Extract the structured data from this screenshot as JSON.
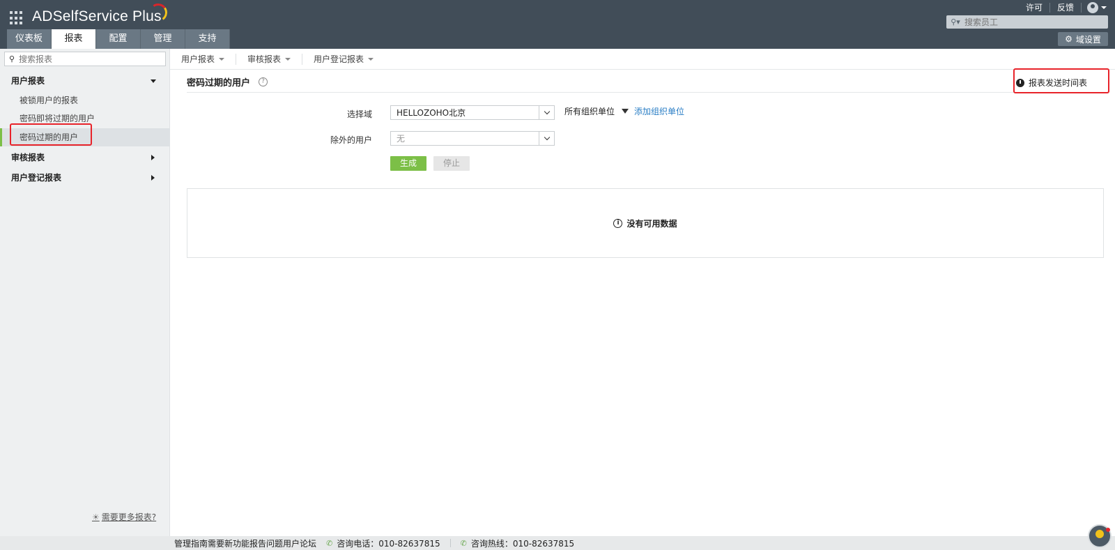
{
  "app": {
    "logo_main": "ADSelfService",
    "logo_plus": " Plus"
  },
  "top_links": [
    "许可",
    "反馈"
  ],
  "employee_search": {
    "placeholder": "搜索员工"
  },
  "nav_tabs": [
    "仪表板",
    "报表",
    "配置",
    "管理",
    "支持"
  ],
  "active_tab": "报表",
  "domain_settings_label": "域设置",
  "sidebar": {
    "search_placeholder": "搜索报表",
    "groups": [
      {
        "label": "用户报表",
        "expanded": true,
        "items": [
          "被锁用户的报表",
          "密码即将过期的用户",
          "密码过期的用户"
        ]
      },
      {
        "label": "审核报表",
        "expanded": false
      },
      {
        "label": "用户登记报表",
        "expanded": false
      }
    ],
    "active_item": "密码过期的用户",
    "more_reports": "需要更多报表?"
  },
  "subnav": [
    "用户报表",
    "审核报表",
    "用户登记报表"
  ],
  "page": {
    "title": "密码过期的用户",
    "help_symbol": "?",
    "schedule_label": "报表发送时间表",
    "form": {
      "domain_label": "选择域",
      "domain_value": "HELLOZOHO北京",
      "ou_text": "所有组织单位",
      "add_ou_link": "添加组织单位",
      "exclude_label": "除外的用户",
      "exclude_value": "无",
      "generate_label": "生成",
      "stop_label": "停止"
    },
    "no_data": "没有可用数据",
    "info_symbol": "i"
  },
  "footer": {
    "links": [
      "管理指南",
      "需要新功能",
      "报告问题",
      "用户论坛"
    ],
    "phone1": "咨询电话：010-82637815",
    "phone2": "咨询热线：010-82637815"
  },
  "colors": {
    "header_bg": "#414d58",
    "accent_green": "#7cbf47",
    "highlight_red": "#e8232a",
    "link_blue": "#2a7ec5"
  }
}
